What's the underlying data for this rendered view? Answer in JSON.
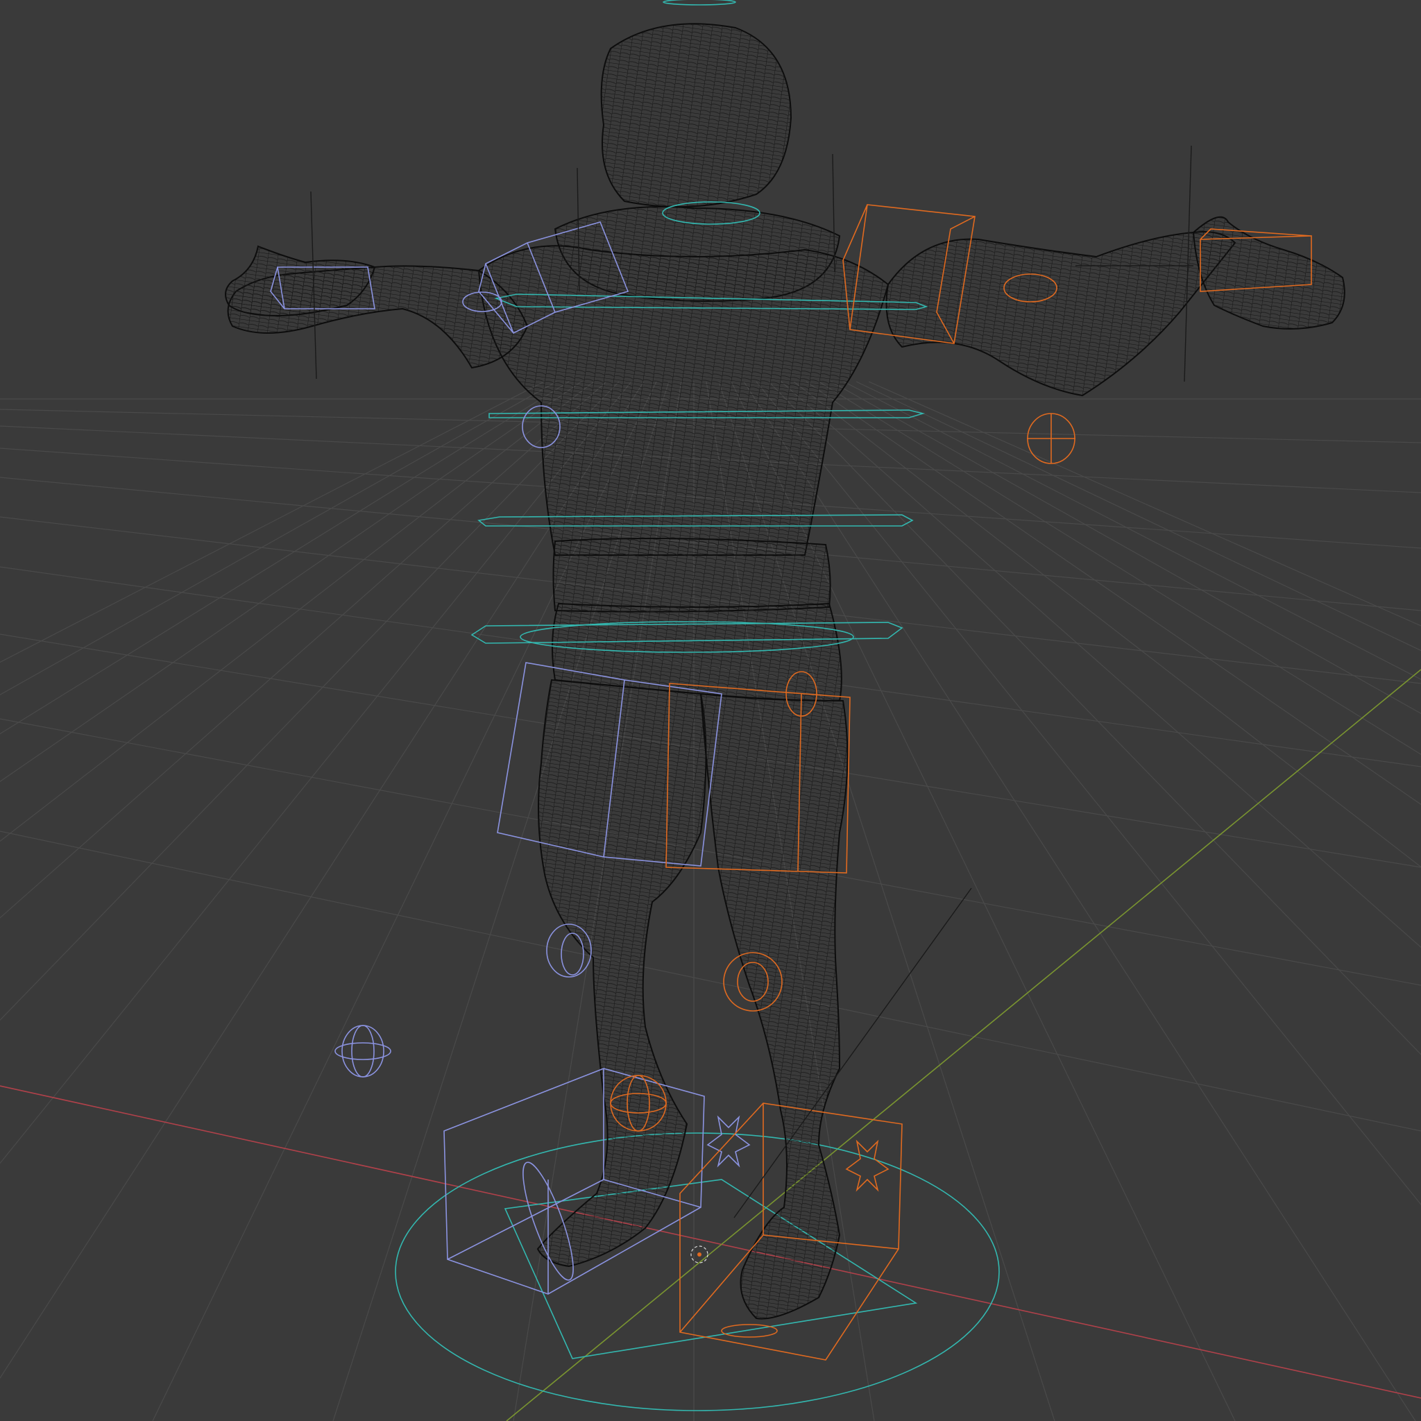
{
  "viewport": {
    "mode": "wireframe",
    "background": "#3a3a3a",
    "shading": "wireframe"
  },
  "colors": {
    "grid": "#4a4a4a",
    "mesh": "#111111",
    "x_axis": "#b0414a",
    "y_axis": "#7a9530",
    "left_controls": "#8b93e0",
    "right_controls": "#e06a20",
    "center_controls": "#33b8b0"
  },
  "scene": {
    "object": "character-rig",
    "pose": "T-pose",
    "controls": {
      "left_side_color": "blue",
      "right_side_color": "orange",
      "center_color": "cyan"
    }
  }
}
